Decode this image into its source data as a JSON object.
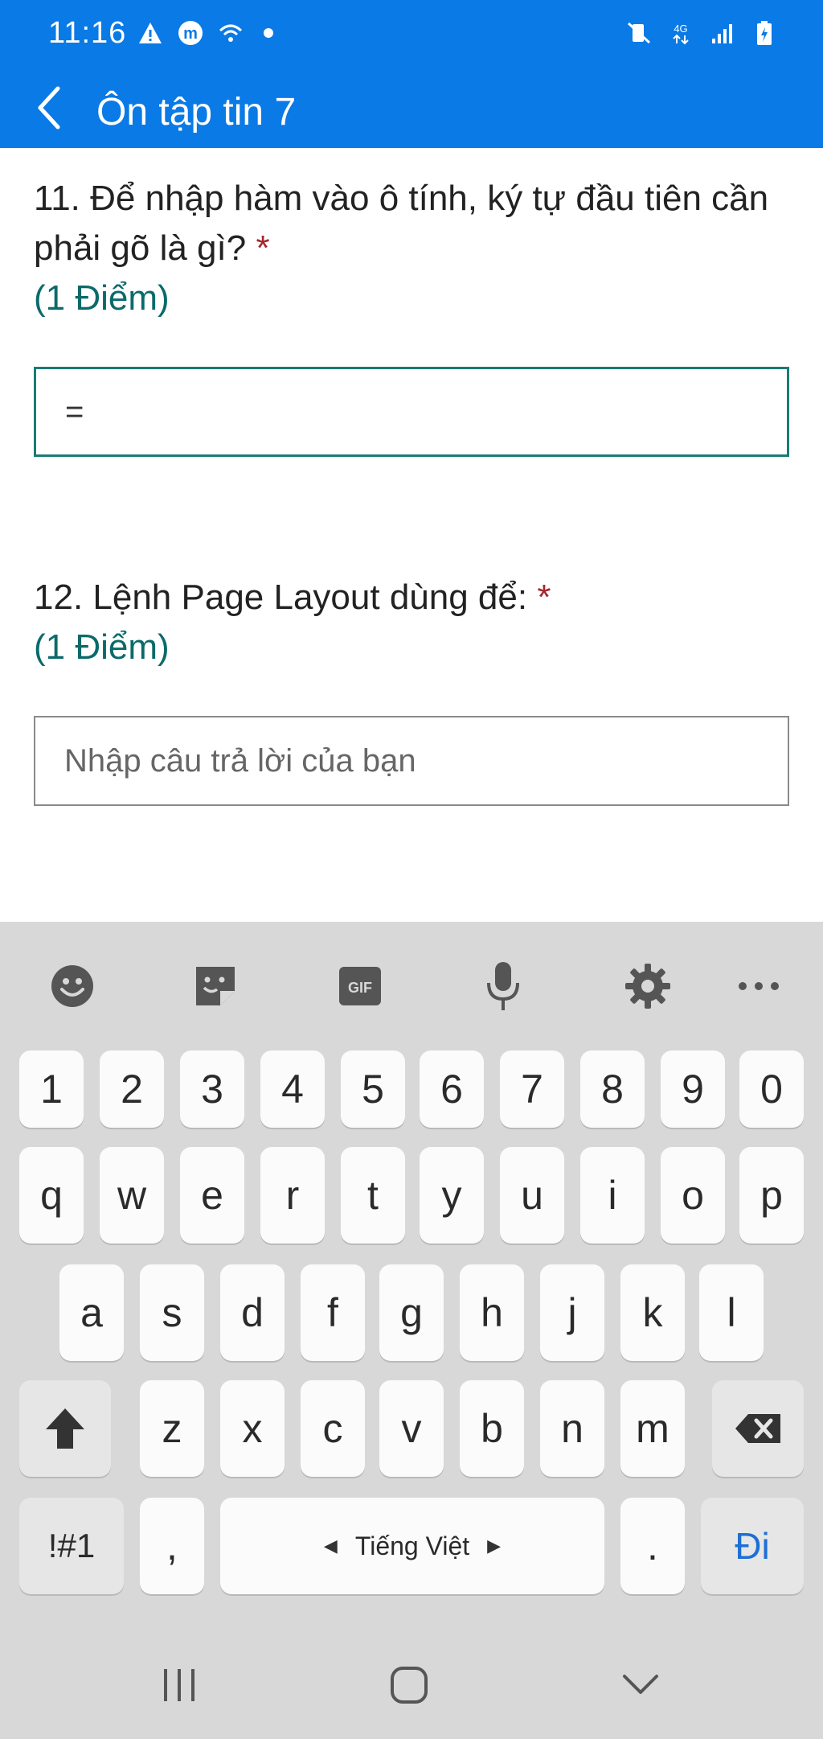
{
  "status_bar": {
    "time": "11:16",
    "icons_left": [
      "warning-icon",
      "m-app-icon",
      "wifi-call-icon",
      "dot-icon"
    ],
    "icons_right": [
      "mute-vibrate-icon",
      "4g-icon",
      "signal-icon",
      "battery-icon"
    ]
  },
  "app_bar": {
    "title": "Ôn tập tin 7",
    "back_icon": "chevron-left-icon",
    "color": "#0a7ae6"
  },
  "questions": [
    {
      "text": "11. Để nhập hàm vào ô tính, ký tự đầu tiên cần phải gõ là gì?",
      "required_mark": "*",
      "points": "(1 Điểm)",
      "answer_value": "=",
      "answer_placeholder": ""
    },
    {
      "text": "12. Lệnh Page Layout dùng để:",
      "required_mark": "*",
      "points": "(1 Điểm)",
      "answer_value": "",
      "answer_placeholder": "Nhập câu trả lời của bạn"
    }
  ],
  "keyboard": {
    "toolbar": [
      "emoji-icon",
      "sticker-icon",
      "gif-icon",
      "microphone-icon",
      "gear-icon",
      "more-icon"
    ],
    "row_numbers": [
      "1",
      "2",
      "3",
      "4",
      "5",
      "6",
      "7",
      "8",
      "9",
      "0"
    ],
    "row_q": [
      "q",
      "w",
      "e",
      "r",
      "t",
      "y",
      "u",
      "i",
      "o",
      "p"
    ],
    "row_a": [
      "a",
      "s",
      "d",
      "f",
      "g",
      "h",
      "j",
      "k",
      "l"
    ],
    "row_z": [
      "z",
      "x",
      "c",
      "v",
      "b",
      "n",
      "m"
    ],
    "symbols_label": "!#1",
    "comma_label": ",",
    "space_label": "Tiếng Việt",
    "period_label": ".",
    "go_label": "Đi"
  },
  "nav_bar": [
    "recents-icon",
    "home-icon",
    "back-down-icon"
  ]
}
